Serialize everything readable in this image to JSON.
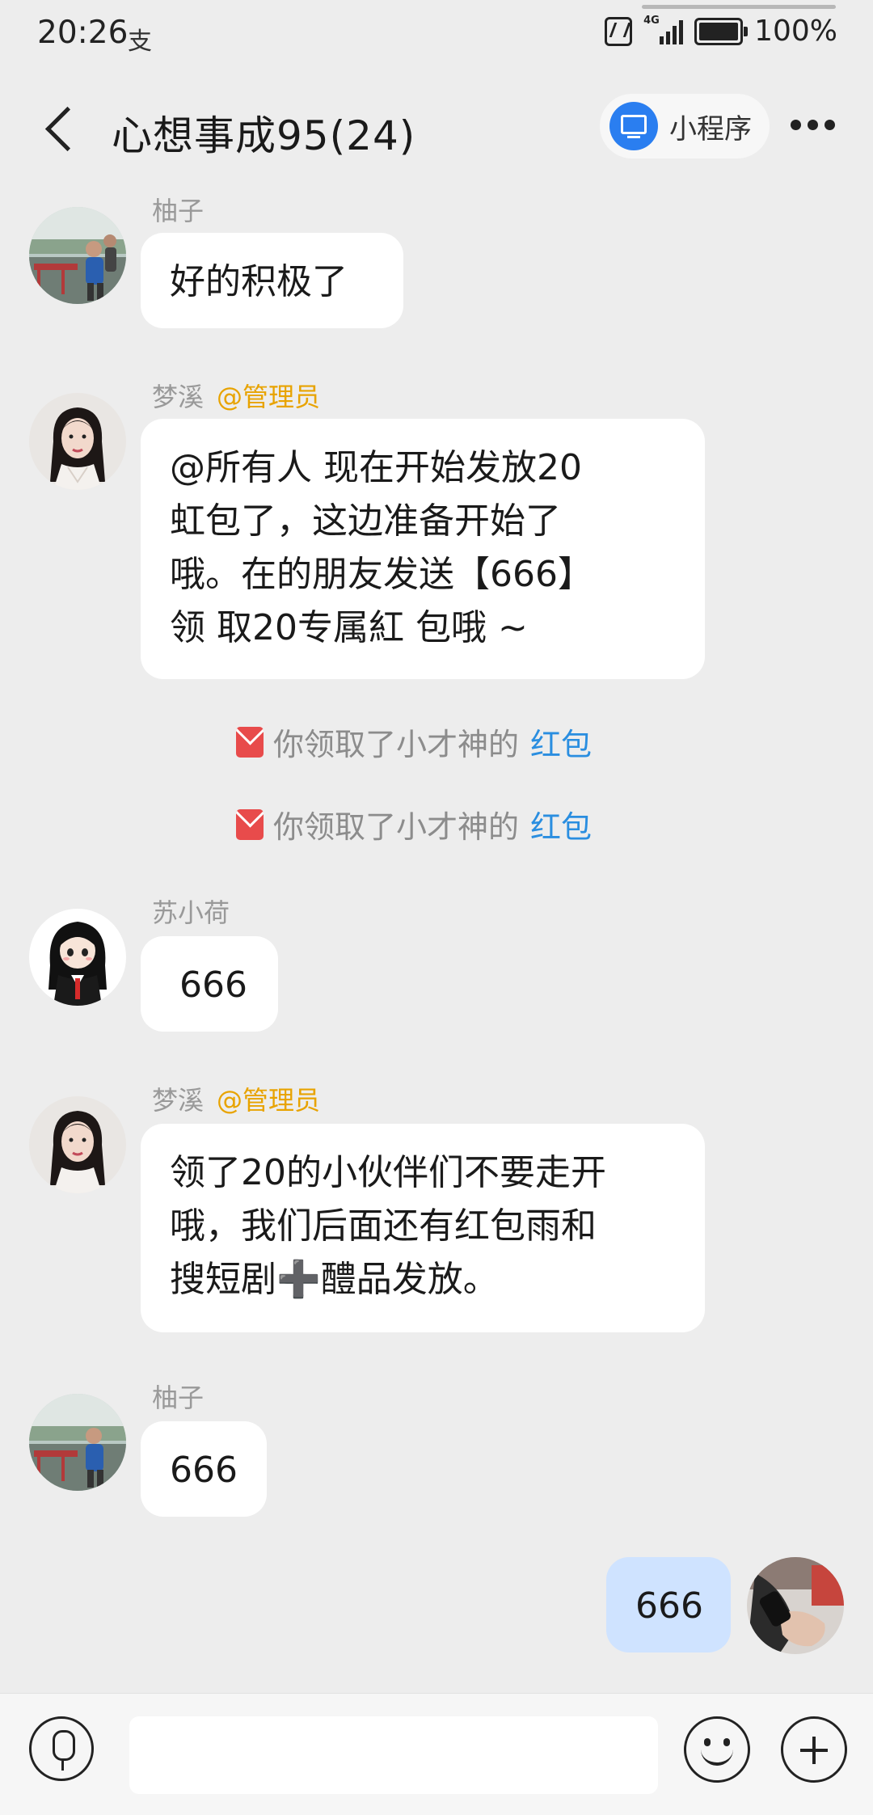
{
  "status_bar": {
    "time": "20:26",
    "app_indicator": "支",
    "network": "4G",
    "battery": "100%"
  },
  "header": {
    "title": "心想事成95(24)",
    "mini_program_label": "小程序"
  },
  "messages": [
    {
      "sender": "柚子",
      "text": "好的积极了"
    },
    {
      "sender": "梦溪",
      "badge": "@管理员",
      "text": "@所有人 现在开始发放20\n虹包了，这边准备开始了\n哦。在的朋友发送【666】\n领 取20专属紅 包哦 ~"
    },
    {
      "sender": "苏小荷",
      "text": "666"
    },
    {
      "sender": "梦溪",
      "badge": "@管理员",
      "text": "领了20的小伙伴们不要走开\n哦，我们后面还有红包雨和\n搜短剧➕醴品发放。"
    },
    {
      "sender": "柚子",
      "text": "666"
    },
    {
      "sender": "",
      "text": "666"
    }
  ],
  "system_notices": [
    {
      "text": "你领取了小才神的",
      "link": "红包"
    },
    {
      "text": "你领取了小才神的",
      "link": "红包"
    }
  ],
  "colors": {
    "background": "#ededed",
    "bubble": "#ffffff",
    "my_bubble": "#cfe3ff",
    "admin_badge": "#e8a300",
    "link": "#2a8ee0",
    "red_packet": "#e84b4b",
    "mini_program_icon": "#2a7ef0"
  },
  "icons": [
    "back-arrow-icon",
    "monitor-icon",
    "more-icon",
    "red-packet-icon",
    "voice-icon",
    "emoji-icon",
    "plus-icon",
    "nfc-icon",
    "signal-icon",
    "battery-icon"
  ]
}
